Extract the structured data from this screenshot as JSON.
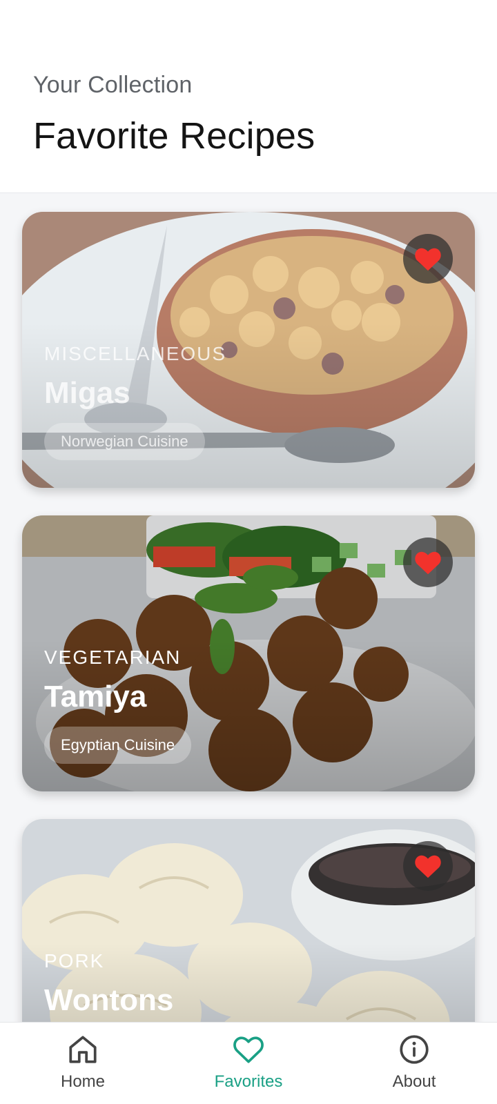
{
  "header": {
    "subtitle": "Your Collection",
    "title": "Favorite Recipes"
  },
  "recipes": [
    {
      "category": "MISCELLANEOUS",
      "name": "Migas",
      "cuisine": "Norwegian Cuisine",
      "favorited": true,
      "image_icon": "bowl-of-migas"
    },
    {
      "category": "VEGETARIAN",
      "name": "Tamiya",
      "cuisine": "Egyptian Cuisine",
      "favorited": true,
      "image_icon": "plate-of-falafel"
    },
    {
      "category": "PORK",
      "name": "Wontons",
      "favorited": true,
      "image_icon": "dumplings-with-sauce"
    }
  ],
  "nav": {
    "items": [
      {
        "label": "Home",
        "icon": "home-icon",
        "active": false
      },
      {
        "label": "Favorites",
        "icon": "heart-icon",
        "active": true
      },
      {
        "label": "About",
        "icon": "info-icon",
        "active": false
      }
    ]
  },
  "colors": {
    "accent": "#1aa085",
    "heart": "#f2322c",
    "background": "#f5f6f8"
  }
}
